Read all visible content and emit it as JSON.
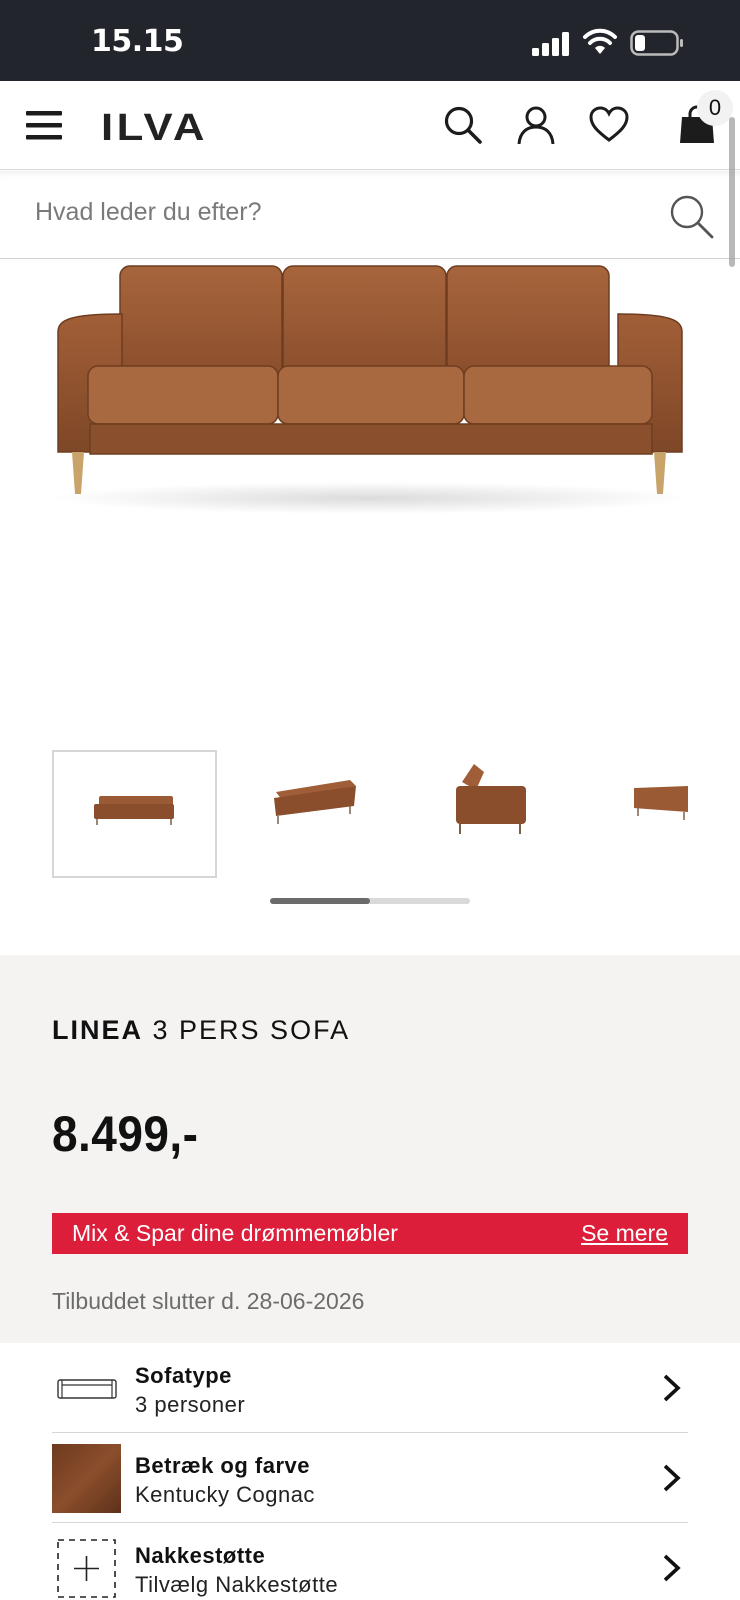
{
  "status_bar": {
    "time": "15.15"
  },
  "header": {
    "logo": "ILVA",
    "cart_count": "0",
    "icons": [
      "menu-icon",
      "search-icon",
      "account-icon",
      "heart-icon",
      "shopping-bag-icon"
    ]
  },
  "search": {
    "placeholder": "Hvad leder du efter?"
  },
  "gallery": {
    "thumbnails": [
      "front",
      "angle",
      "side",
      "back"
    ],
    "active_index": 0,
    "scroll_position": 0.5
  },
  "product": {
    "brand": "LINEA",
    "type": "3 PERS SOFA",
    "price": "8.499,-",
    "promo_text": "Mix & Spar dine drømmemøbler",
    "promo_link": "Se mere",
    "offer_end": "Tilbuddet slutter d. 28-06-2026"
  },
  "options": [
    {
      "title": "Sofatype",
      "value": "3 personer"
    },
    {
      "title": "Betræk og farve",
      "value": "Kentucky Cognac"
    },
    {
      "title": "Nakkestøtte",
      "value": "Tilvælg Nakkestøtte"
    }
  ],
  "colors": {
    "status_bar": "#22252c",
    "promo": "#dc1e3a",
    "info_bg": "#f4f3f1",
    "leather": "#9a5a34"
  }
}
